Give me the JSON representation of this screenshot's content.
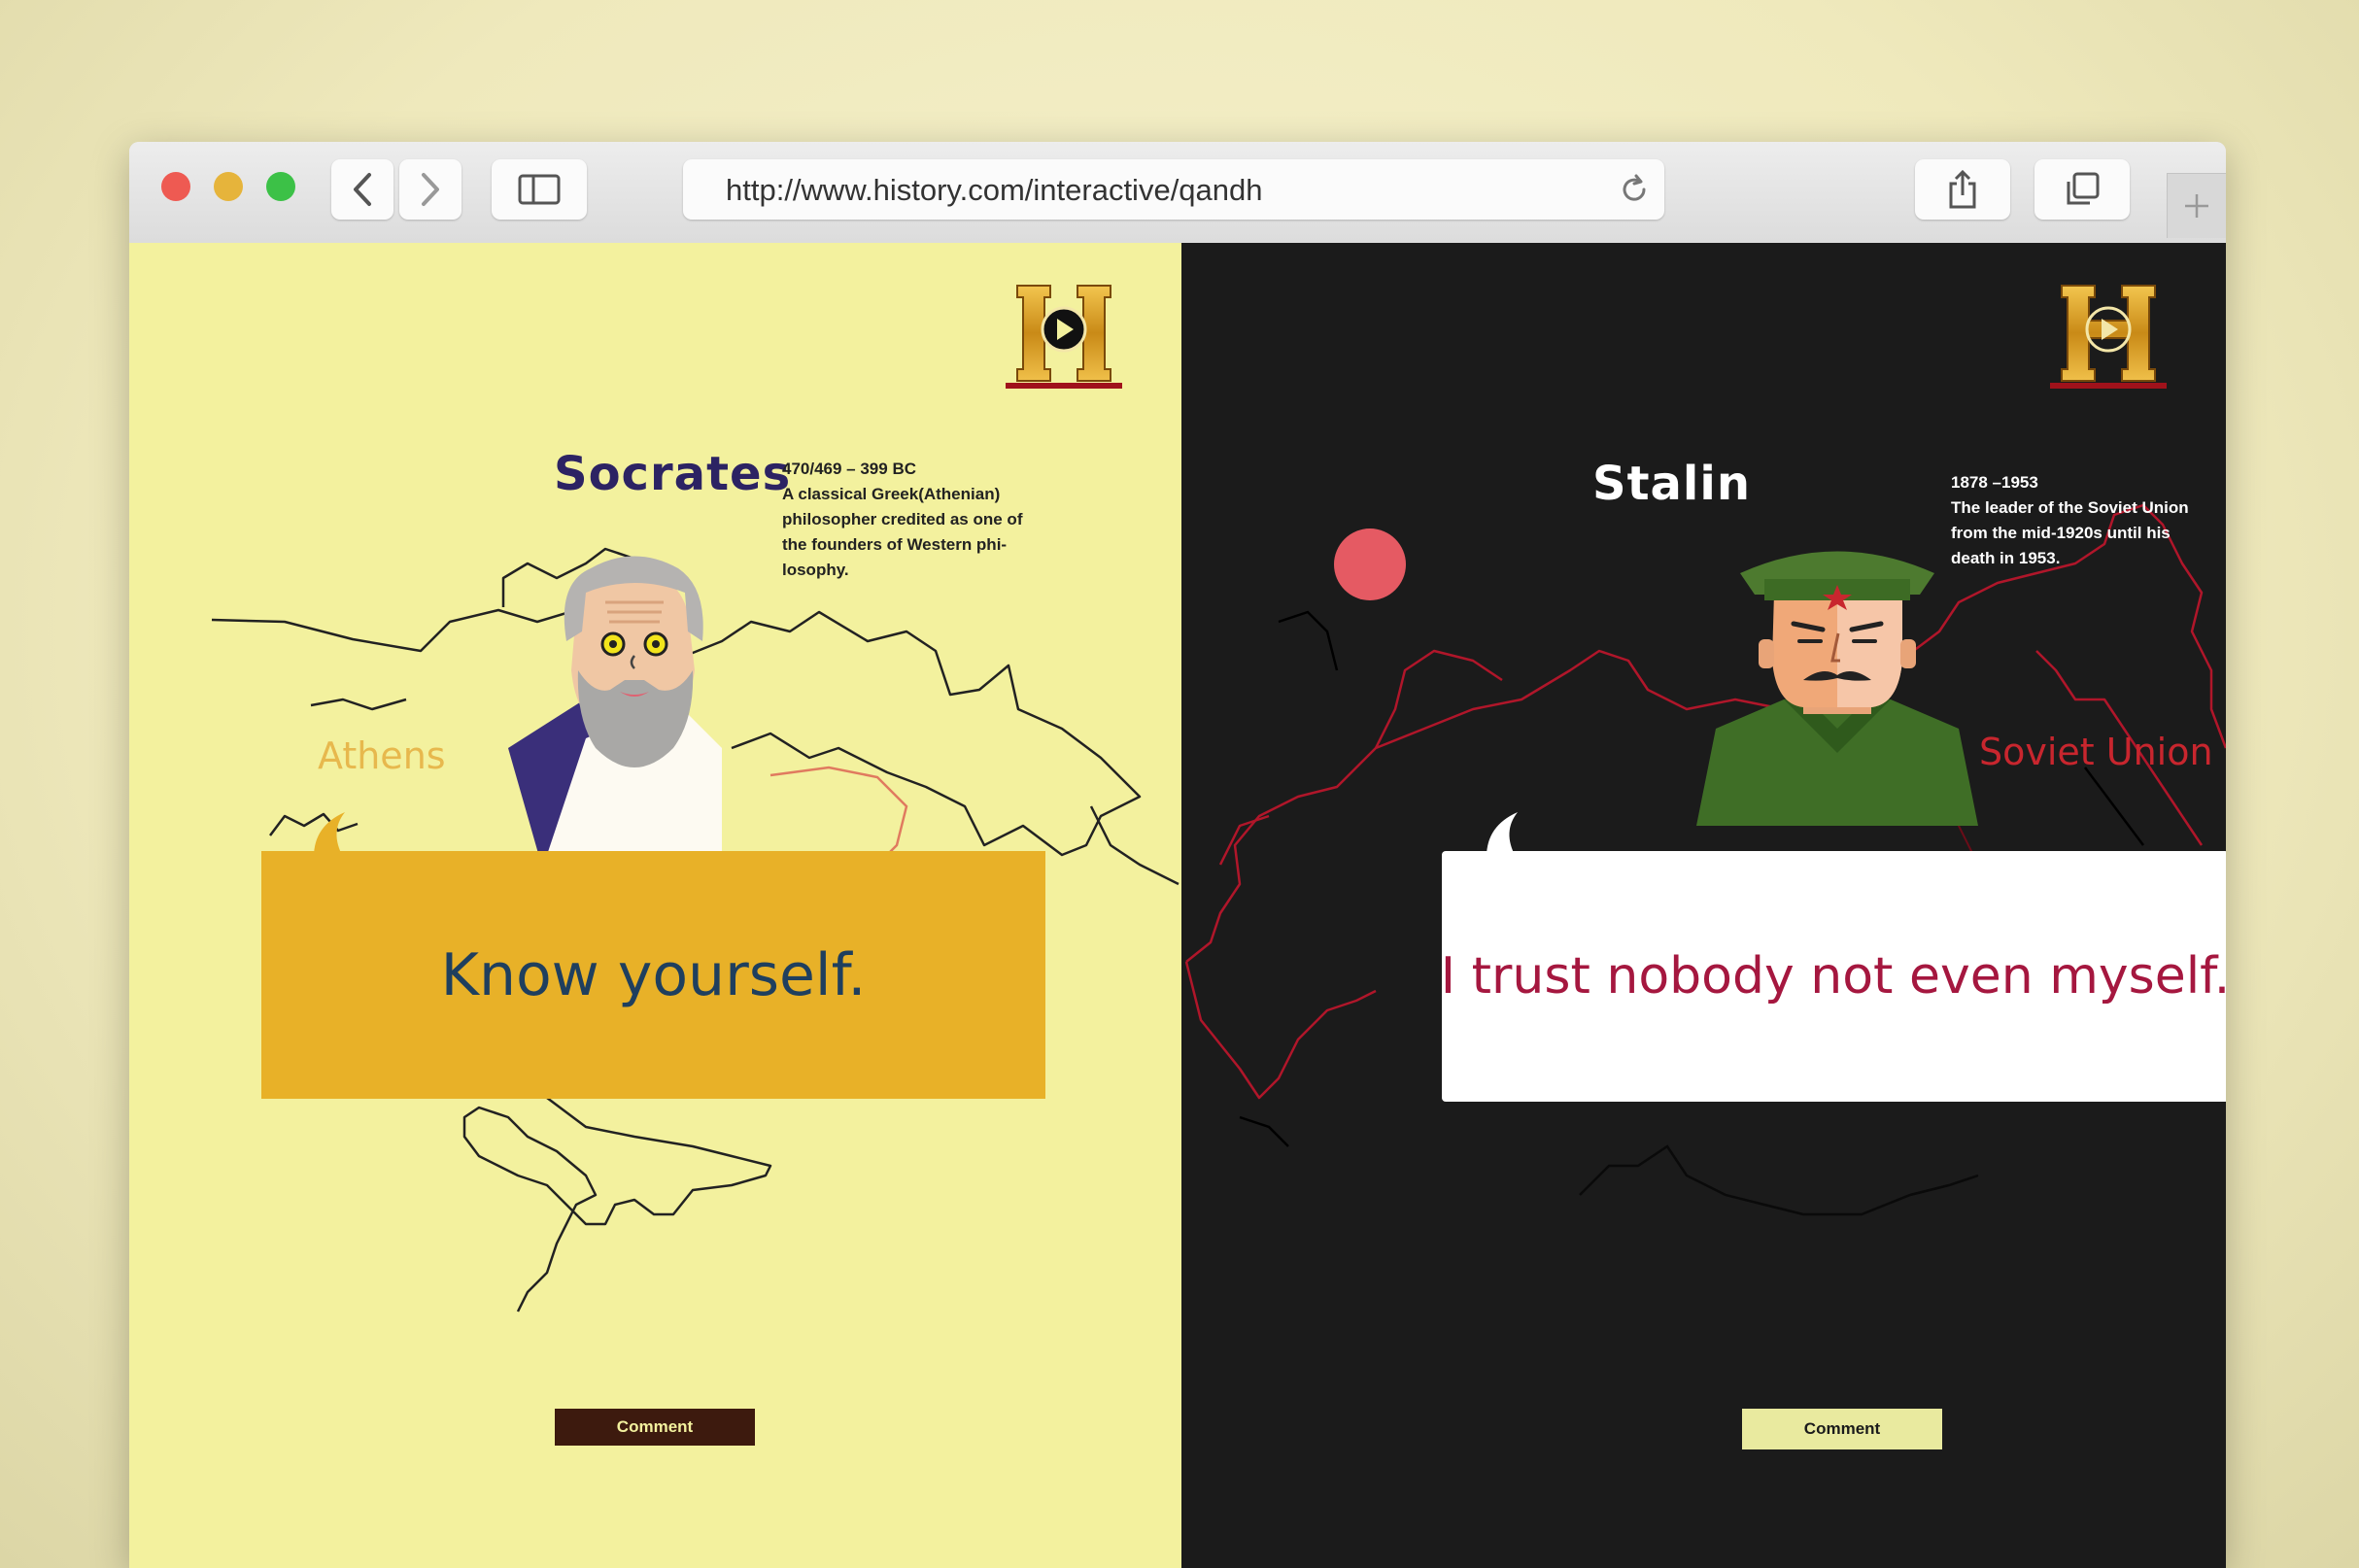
{
  "browser": {
    "url": "http://www.history.com/interactive/qandh",
    "traffic_lights": {
      "close": "#ee5a52",
      "minimize": "#e6b43b",
      "zoom": "#3cc147"
    },
    "icons": [
      "back-icon",
      "forward-icon",
      "sidebar-icon",
      "reload-icon",
      "share-icon",
      "tabs-overview-icon",
      "new-tab-icon"
    ]
  },
  "left": {
    "logo_letter": "H",
    "name": "Socrates",
    "bio": [
      "470/469 – 399 BC",
      "A classical Greek(Athenian)",
      "philosopher credited as one of",
      "the founders of Western phi-",
      "losophy."
    ],
    "place": "Athens",
    "quote": "Know yourself.",
    "comment_label": "Comment",
    "colors": {
      "background": "#f3f19e",
      "bubble": "#e8b128",
      "quote": "#1f3f5e",
      "name": "#2c2363",
      "place": "#e7b84d",
      "comment_bg": "#3d1a0e",
      "comment_text": "#f3f19e"
    }
  },
  "right": {
    "logo_letter": "H",
    "name": "Stalin",
    "bio": [
      "1878 –1953",
      "The leader of the Soviet Union",
      "from the mid-1920s until his",
      "death in 1953."
    ],
    "place": "Soviet Union",
    "quote": "I trust nobody not even myself.",
    "comment_label": "Comment",
    "colors": {
      "background": "#1b1b1b",
      "bubble": "#ffffff",
      "quote": "#a5173f",
      "name": "#ffffff",
      "place": "#c8262e",
      "map_line": "#b0162a",
      "comment_bg": "#e9ea9f",
      "comment_text": "#1b1b1b"
    }
  }
}
